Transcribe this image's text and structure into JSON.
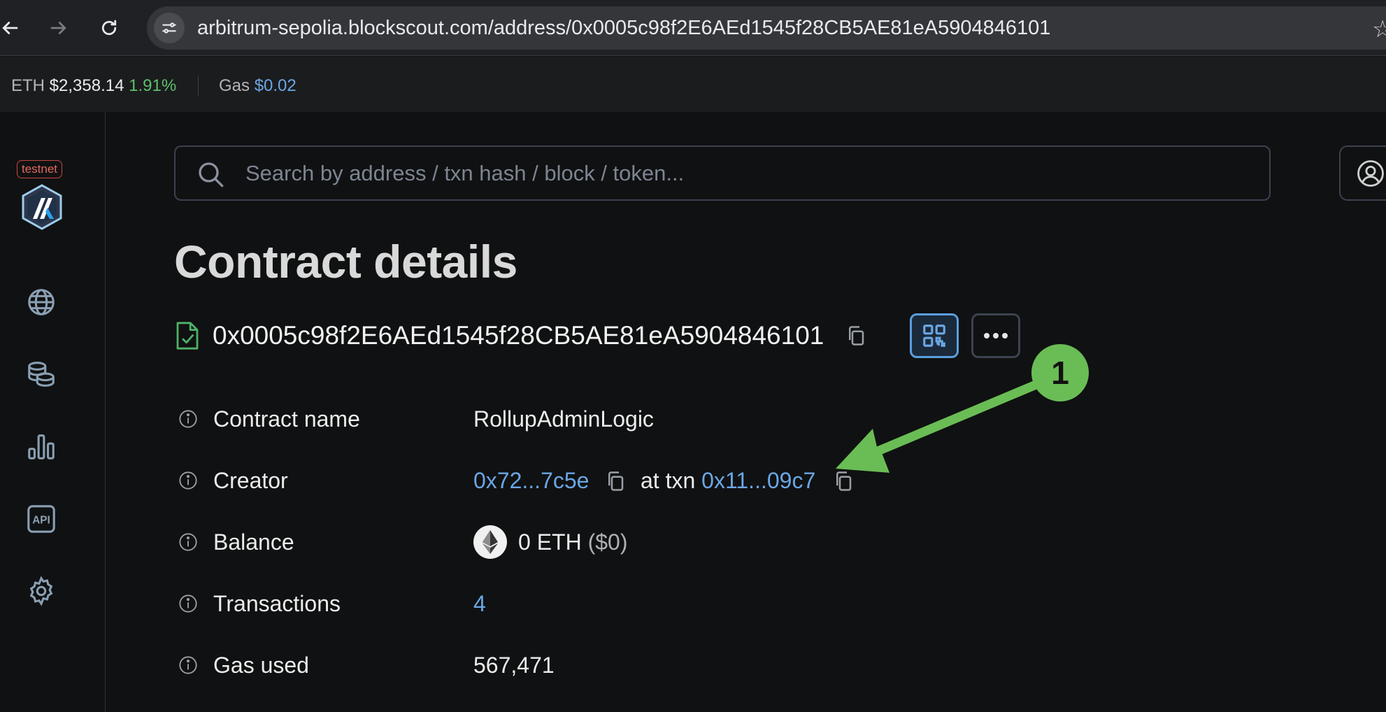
{
  "browser": {
    "url": "arbitrum-sepolia.blockscout.com/address/0x0005c98f2E6AEd1545f28CB5AE81eA5904846101"
  },
  "stats": {
    "eth_label": "ETH",
    "eth_price": "$2,358.14",
    "eth_change": "1.91%",
    "gas_label": "Gas",
    "gas_price": "$0.02"
  },
  "sidebar": {
    "badge": "testnet",
    "icons": [
      "globe-icon",
      "coins-icon",
      "chart-icon",
      "api-icon",
      "gear-icon"
    ],
    "api_text": "API"
  },
  "search": {
    "placeholder": "Search by address / txn hash / block / token..."
  },
  "page": {
    "title": "Contract details",
    "address": "0x0005c98f2E6AEd1545f28CB5AE81eA5904846101"
  },
  "details": {
    "contract_name_label": "Contract name",
    "contract_name_value": "RollupAdminLogic",
    "creator_label": "Creator",
    "creator_address": "0x72...7c5e",
    "creator_at_txn": "at txn",
    "creator_txn": "0x11...09c7",
    "balance_label": "Balance",
    "balance_value": "0 ETH",
    "balance_usd": "($0)",
    "transactions_label": "Transactions",
    "transactions_value": "4",
    "gas_used_label": "Gas used",
    "gas_used_value": "567,471"
  },
  "annotation": {
    "number": "1",
    "color": "#6abd55"
  },
  "colors": {
    "link": "#6aa7e4",
    "positive": "#5fbf6b",
    "accent": "#5a9fde"
  }
}
